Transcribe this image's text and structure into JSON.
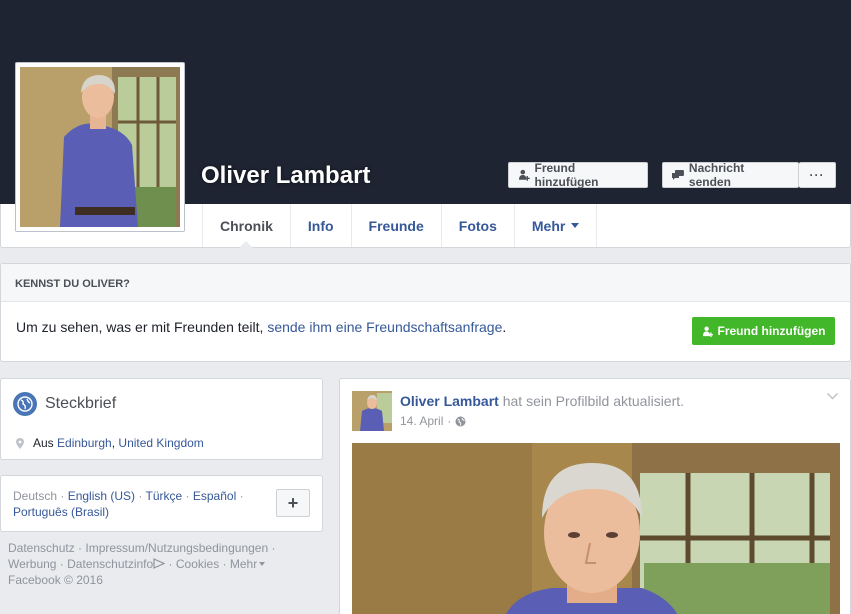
{
  "profile": {
    "name": "Oliver Lambart",
    "add_friend_label": "Freund hinzufügen",
    "message_label": "Nachricht senden",
    "more_label": "···"
  },
  "tabs": [
    {
      "label": "Chronik"
    },
    {
      "label": "Info"
    },
    {
      "label": "Freunde"
    },
    {
      "label": "Fotos"
    },
    {
      "label": "Mehr"
    }
  ],
  "know": {
    "heading": "KENNST DU OLIVER?",
    "text_prefix": "Um zu sehen, was er mit Freunden teilt, ",
    "text_link": "sende ihm eine Freundschaftsanfrage",
    "text_suffix": ".",
    "button_label": "Freund hinzufügen"
  },
  "intro": {
    "title": "Steckbrief",
    "location_prefix": "Aus ",
    "location_city": "Edinburgh",
    "location_sep": ", ",
    "location_country": "United Kingdom"
  },
  "languages": {
    "current": "Deutsch",
    "others": [
      "English (US)",
      "Türkçe",
      "Español",
      "Português (Brasil)"
    ],
    "sep": " · ",
    "plus": "+"
  },
  "footer": {
    "line1": "Datenschutz · Impressum/Nutzungsbedingungen ·",
    "line2a": "Werbung · Datenschutzinfo",
    "line2b": " · Cookies · Mehr",
    "line3": "Facebook © 2016"
  },
  "post": {
    "author": "Oliver Lambart",
    "action": " hat sein Profilbild aktualisiert.",
    "date": "14. April",
    "meta_sep": " · "
  },
  "colors": {
    "cover": "#1f2432",
    "link": "#365899",
    "green": "#42b72a"
  }
}
